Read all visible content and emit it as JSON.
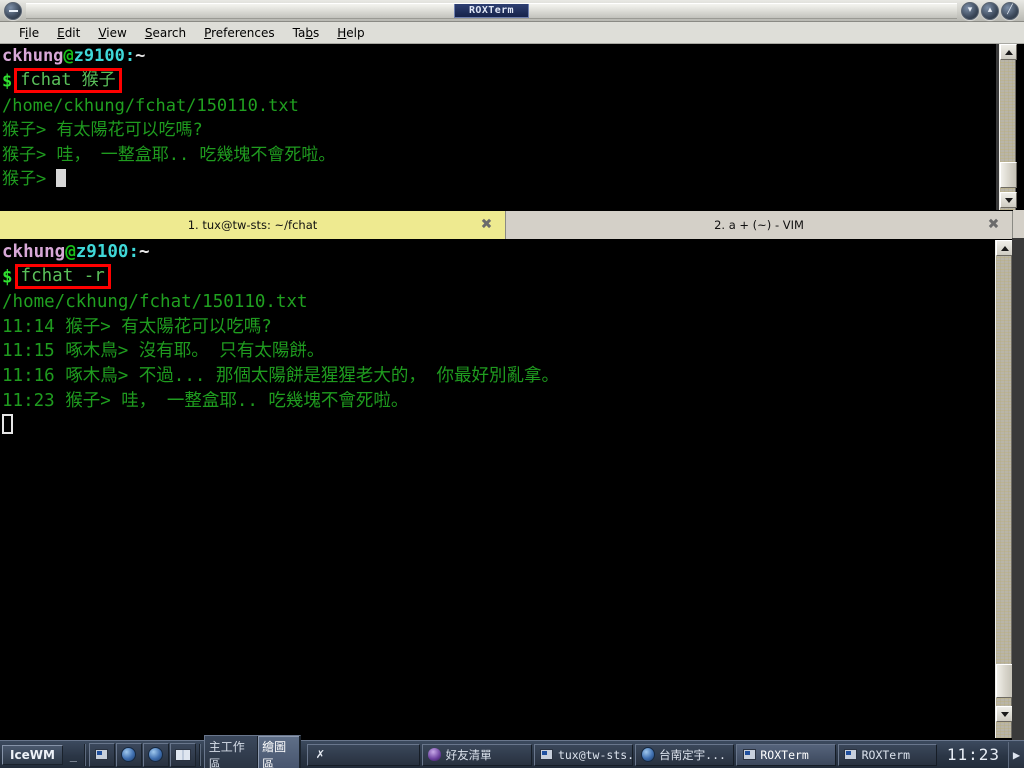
{
  "window": {
    "title": "ROXTerm",
    "system_menu_icon": "window-menu-icon",
    "minimize_label": "▾",
    "maximize_label": "▴",
    "close_label": "╱"
  },
  "menubar": {
    "items": [
      {
        "name": "file",
        "pre": "F",
        "mnemonic": "i",
        "post": "le"
      },
      {
        "name": "edit",
        "pre": "",
        "mnemonic": "E",
        "post": "dit"
      },
      {
        "name": "view",
        "pre": "",
        "mnemonic": "V",
        "post": "iew"
      },
      {
        "name": "search",
        "pre": "",
        "mnemonic": "S",
        "post": "earch"
      },
      {
        "name": "preferences",
        "pre": "",
        "mnemonic": "P",
        "post": "references"
      },
      {
        "name": "tabs",
        "pre": "Ta",
        "mnemonic": "b",
        "post": "s"
      },
      {
        "name": "help",
        "pre": "",
        "mnemonic": "H",
        "post": "elp"
      }
    ]
  },
  "tabs": {
    "items": [
      {
        "label": "1. tux@tw-sts: ~/fchat",
        "active": true,
        "close": "✖"
      },
      {
        "label": "2. a + (~) - VIM",
        "active": false,
        "close": "✖"
      }
    ]
  },
  "terminal_top": {
    "prompt": {
      "user": "ckhung",
      "at": "@",
      "host": "z9100",
      "colon": ":",
      "cwd": "~"
    },
    "dollar": "$",
    "command": "fchat 猴子",
    "command_highlighted": true,
    "lines": [
      "/home/ckhung/fchat/150110.txt",
      "猴子> 有太陽花可以吃嗎?",
      "猴子> 哇， 一整盒耶.. 吃幾塊不會死啦。",
      "猴子> "
    ]
  },
  "terminal_bottom": {
    "prompt": {
      "user": "ckhung",
      "at": "@",
      "host": "z9100",
      "colon": ":",
      "cwd": "~"
    },
    "dollar": "$",
    "command": "fchat -r",
    "command_highlighted": true,
    "lines": [
      "/home/ckhung/fchat/150110.txt",
      "11:14 猴子> 有太陽花可以吃嗎?",
      "11:15 啄木鳥> 沒有耶。 只有太陽餅。",
      "11:16 啄木鳥> 不過... 那個太陽餅是猩猩老大的， 你最好別亂拿。",
      "11:23 猴子> 哇， 一整盒耶.. 吃幾塊不會死啦。"
    ]
  },
  "scrollbars": {
    "up_arrow": "▲",
    "down_arrow": "▼"
  },
  "taskbar": {
    "start_label": "IceWM",
    "show_desktop_label": "_",
    "launchers": [
      {
        "name": "terminal-launcher",
        "icon": "monitor-icon"
      },
      {
        "name": "browser-launcher",
        "icon": "globe-icon"
      },
      {
        "name": "web-launcher",
        "icon": "globe2-icon"
      },
      {
        "name": "dictionary-launcher",
        "icon": "book-icon"
      }
    ],
    "workspaces": [
      {
        "label": "主工作區",
        "active": false
      },
      {
        "label": "繪圖區",
        "active": true
      }
    ],
    "windows": [
      {
        "label": "",
        "icon": "x-icon",
        "focused": false
      },
      {
        "label": "好友清單",
        "icon": "penguin-icon",
        "focused": false
      },
      {
        "label": "tux@tw-sts...",
        "icon": "monitor-icon",
        "focused": false
      },
      {
        "label": "台南定宇...",
        "icon": "globe-icon",
        "focused": false
      },
      {
        "label": "ROXTerm",
        "icon": "monitor-icon",
        "focused": true
      },
      {
        "label": "ROXTerm",
        "icon": "monitor-icon",
        "focused": false
      }
    ],
    "clock": "11:23",
    "tray_arrow": "▶"
  },
  "colors": {
    "terminal_bg": "#000000",
    "terminal_green": "#18a018",
    "highlight_red": "#ff0000",
    "tab_active_bg": "#eeea90",
    "titlebar_accent": "#16234a"
  }
}
